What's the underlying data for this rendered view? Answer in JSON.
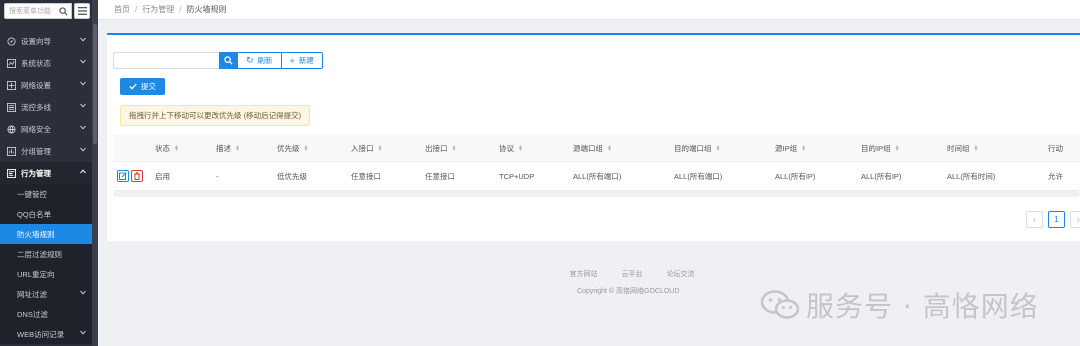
{
  "sidebar": {
    "search_placeholder": "搜索菜单功能",
    "items": [
      {
        "label": "设置向导",
        "icon": "compass-icon"
      },
      {
        "label": "系统状态",
        "icon": "chart-icon"
      },
      {
        "label": "网络设置",
        "icon": "network-icon"
      },
      {
        "label": "流控多线",
        "icon": "flow-icon"
      },
      {
        "label": "网络安全",
        "icon": "shield-icon"
      },
      {
        "label": "分组管理",
        "icon": "group-icon"
      },
      {
        "label": "行为管理",
        "icon": "behavior-icon"
      }
    ],
    "sub_items": [
      {
        "label": "一键管控"
      },
      {
        "label": "QQ白名单"
      },
      {
        "label": "防火墙规则"
      },
      {
        "label": "二层过滤规则"
      },
      {
        "label": "URL重定向"
      },
      {
        "label": "网址过滤"
      },
      {
        "label": "DNS过滤"
      },
      {
        "label": "WEB访问记录"
      }
    ]
  },
  "breadcrumb": {
    "home": "首页",
    "section": "行为管理",
    "current": "防火墙规则"
  },
  "toolbar": {
    "refresh_label": "刷新",
    "new_label": "新建"
  },
  "submit_label": "提交",
  "hint": "拖拽行并上下移动可以更改优先级 (移动后记得提交)",
  "table": {
    "headers": [
      "状态",
      "描述",
      "优先级",
      "入接口",
      "出接口",
      "协议",
      "源端口组",
      "目的端口组",
      "源IP组",
      "目的IP组",
      "时间组",
      "行动"
    ],
    "rows": [
      [
        "启用",
        "-",
        "低优先级",
        "任意接口",
        "任意接口",
        "TCP+UDP",
        "ALL(所有端口)",
        "ALL(所有端口)",
        "ALL(所有IP)",
        "ALL(所有IP)",
        "ALL(所有时间)",
        "允许"
      ]
    ]
  },
  "pagination": {
    "prev": "‹",
    "page": "1",
    "next": "›"
  },
  "footer": {
    "links": [
      "官方网站",
      "云平台",
      "论坛交流"
    ],
    "copyright": "Copyright © 高恪网络GOCLOUD"
  },
  "watermark": "服务号 · 高恪网络",
  "colors": {
    "accent": "#1e88e5",
    "sidebar_bg": "#2b2f3a",
    "danger": "#e53935",
    "hint_bg": "#fdf6e3"
  }
}
